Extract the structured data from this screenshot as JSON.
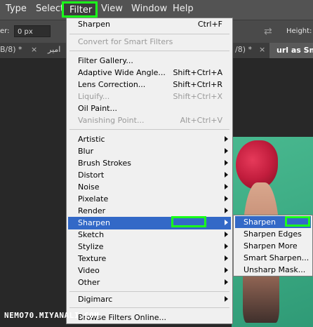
{
  "menubar": {
    "items": [
      "Type",
      "Select",
      "Filter",
      "View",
      "Window",
      "Help"
    ]
  },
  "options": {
    "label": "er:",
    "value": "0 px",
    "height_label": "Height:"
  },
  "tabs": {
    "tab1": "B/8) *",
    "tab1_close": "×",
    "tab2": "امیر",
    "tab3": "/8) *",
    "tab3_close": "×",
    "active": "url as Sm"
  },
  "filter_menu": {
    "last_filter": {
      "label": "Sharpen",
      "shortcut": "Ctrl+F"
    },
    "convert_smart": "Convert for Smart Filters",
    "gallery": "Filter Gallery...",
    "wide_angle": {
      "label": "Adaptive Wide Angle...",
      "shortcut": "Shift+Ctrl+A"
    },
    "lens": {
      "label": "Lens Correction...",
      "shortcut": "Shift+Ctrl+R"
    },
    "liquify": {
      "label": "Liquify...",
      "shortcut": "Shift+Ctrl+X"
    },
    "oil": "Oil Paint...",
    "vanishing": {
      "label": "Vanishing Point...",
      "shortcut": "Alt+Ctrl+V"
    },
    "categories": [
      "Artistic",
      "Blur",
      "Brush Strokes",
      "Distort",
      "Noise",
      "Pixelate",
      "Render",
      "Sharpen",
      "Sketch",
      "Stylize",
      "Texture",
      "Video",
      "Other"
    ],
    "digimarc": "Digimarc",
    "browse": "Browse Filters Online..."
  },
  "sharpen_submenu": {
    "items": [
      "Sharpen",
      "Sharpen Edges",
      "Sharpen More",
      "Smart Sharpen...",
      "Unsharp Mask..."
    ]
  },
  "watermark": "NEMO70.MIYANALI.COM",
  "colors": {
    "highlight": "#3369c7",
    "marker": "#1aff1a",
    "menu_bg": "#f0f0f0",
    "app_bg": "#535353"
  }
}
